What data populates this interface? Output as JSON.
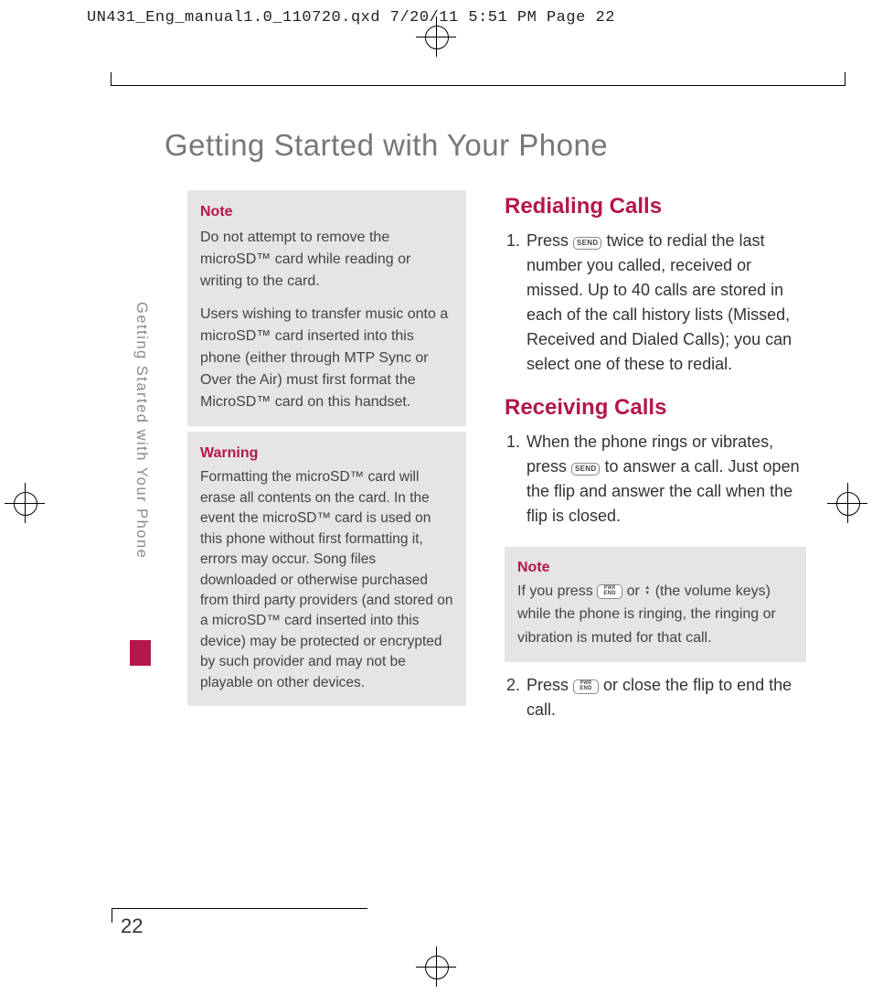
{
  "meta": {
    "header": "UN431_Eng_manual1.0_110720.qxd  7/20/11  5:51 PM  Page 22",
    "page_number": "22",
    "side_label": "Getting Started with Your Phone"
  },
  "title": "Getting Started with Your Phone",
  "left": {
    "note": {
      "label": "Note",
      "p1": "Do not attempt to remove the microSD™ card while reading or writing to the card.",
      "p2": "Users wishing to transfer music onto a microSD™ card inserted into this phone (either through MTP Sync or Over the Air) must first format the MicroSD™ card on this handset."
    },
    "warning": {
      "label": "Warning",
      "body": "Formatting the microSD™ card will erase all contents on the card. In the event the microSD™ card is used on this phone without first formatting it, errors may occur. Song files downloaded or otherwise purchased from third party providers (and stored on a microSD™ card inserted into this device) may be protected or encrypted by such provider and may not be playable on other devices."
    }
  },
  "right": {
    "redialing": {
      "heading": "Redialing Calls",
      "step1_a": "Press ",
      "step1_b": " twice to redial the last number you called, received or missed. Up to 40 calls are stored in each of the call history lists (Missed, Received and Dialed Calls); you can select one of these to redial."
    },
    "receiving": {
      "heading": "Receiving Calls",
      "step1_a": "When the phone rings or vibrates, press ",
      "step1_b": " to answer a call. Just open the flip and answer the call when the flip is closed.",
      "note": {
        "label": "Note",
        "a": "If you press ",
        "b": " or ",
        "c": " (the volume keys) while the phone is ringing, the ringing or vibration is muted for that call."
      },
      "step2_a": "Press ",
      "step2_b": " or close the flip to end the call."
    }
  },
  "keys": {
    "send": "SEND",
    "end_top": "PWR",
    "end_bot": "END"
  }
}
